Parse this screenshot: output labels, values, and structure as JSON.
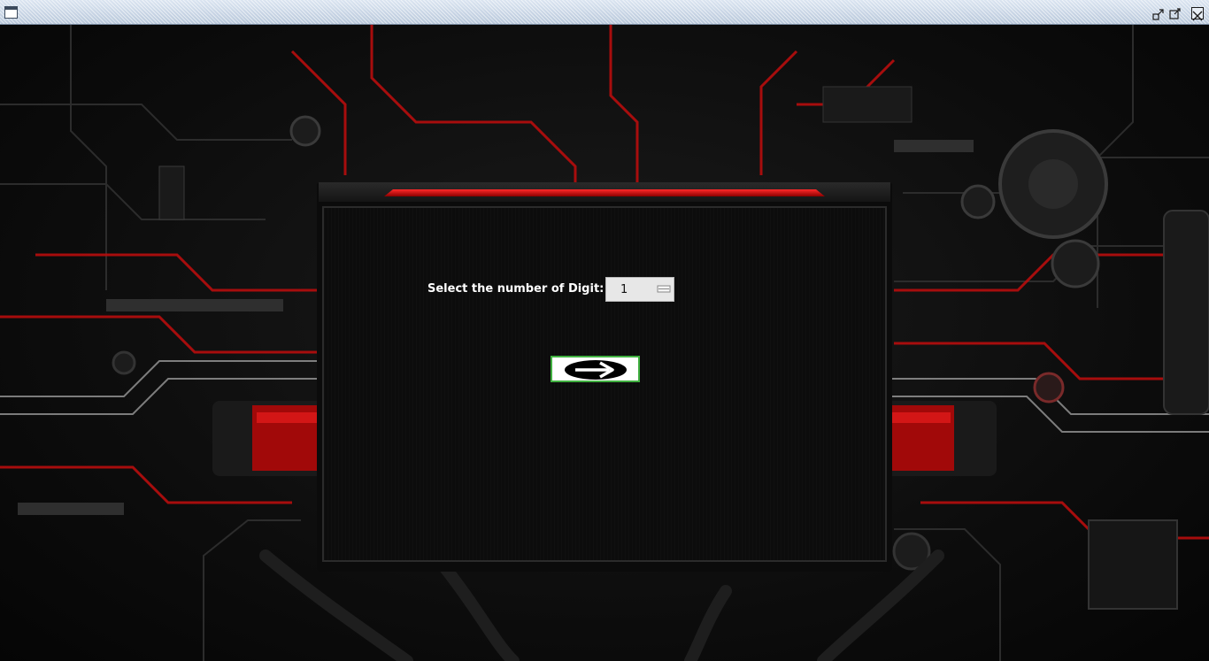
{
  "window": {
    "title": "",
    "controls": {
      "minimize_icon": "restore-down-icon",
      "maximize_icon": "maximize-icon",
      "close_icon": "close-icon"
    }
  },
  "form": {
    "digit_label": "Select the number of Digit:",
    "digit_value": "1",
    "next_button_icon": "right-arrow-icon"
  },
  "colors": {
    "accent_red": "#e01010",
    "panel_bg": "#0c0c0c",
    "button_border": "#40b040"
  }
}
